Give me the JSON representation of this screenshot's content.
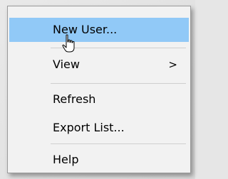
{
  "context_menu": {
    "items": [
      {
        "label": "New User...",
        "submenu": false,
        "highlighted": true
      },
      {
        "label": "View",
        "submenu": true,
        "submenu_arrow": ">"
      },
      {
        "label": "Refresh"
      },
      {
        "label": "Export List..."
      },
      {
        "label": "Help"
      }
    ],
    "highlight_color": "#91c9f7",
    "background_color": "#f2f2f2"
  },
  "cursor": {
    "icon": "hand-pointer-icon"
  }
}
